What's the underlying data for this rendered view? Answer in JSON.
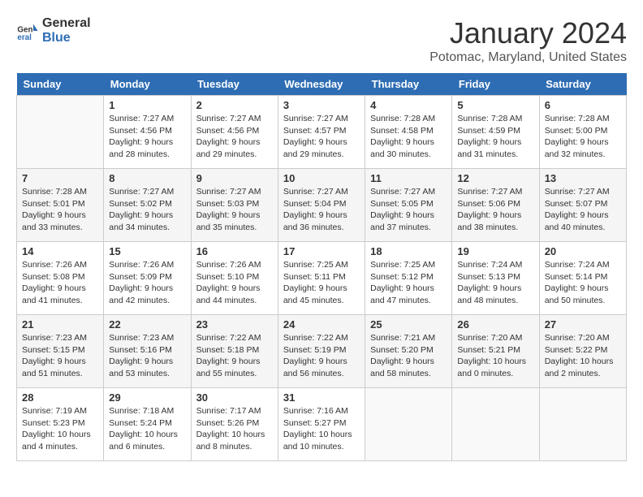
{
  "logo": {
    "line1": "General",
    "line2": "Blue"
  },
  "title": "January 2024",
  "subtitle": "Potomac, Maryland, United States",
  "weekdays": [
    "Sunday",
    "Monday",
    "Tuesday",
    "Wednesday",
    "Thursday",
    "Friday",
    "Saturday"
  ],
  "weeks": [
    [
      {
        "day": "",
        "info": ""
      },
      {
        "day": "1",
        "info": "Sunrise: 7:27 AM\nSunset: 4:56 PM\nDaylight: 9 hours\nand 28 minutes."
      },
      {
        "day": "2",
        "info": "Sunrise: 7:27 AM\nSunset: 4:56 PM\nDaylight: 9 hours\nand 29 minutes."
      },
      {
        "day": "3",
        "info": "Sunrise: 7:27 AM\nSunset: 4:57 PM\nDaylight: 9 hours\nand 29 minutes."
      },
      {
        "day": "4",
        "info": "Sunrise: 7:28 AM\nSunset: 4:58 PM\nDaylight: 9 hours\nand 30 minutes."
      },
      {
        "day": "5",
        "info": "Sunrise: 7:28 AM\nSunset: 4:59 PM\nDaylight: 9 hours\nand 31 minutes."
      },
      {
        "day": "6",
        "info": "Sunrise: 7:28 AM\nSunset: 5:00 PM\nDaylight: 9 hours\nand 32 minutes."
      }
    ],
    [
      {
        "day": "7",
        "info": "Sunrise: 7:28 AM\nSunset: 5:01 PM\nDaylight: 9 hours\nand 33 minutes."
      },
      {
        "day": "8",
        "info": "Sunrise: 7:27 AM\nSunset: 5:02 PM\nDaylight: 9 hours\nand 34 minutes."
      },
      {
        "day": "9",
        "info": "Sunrise: 7:27 AM\nSunset: 5:03 PM\nDaylight: 9 hours\nand 35 minutes."
      },
      {
        "day": "10",
        "info": "Sunrise: 7:27 AM\nSunset: 5:04 PM\nDaylight: 9 hours\nand 36 minutes."
      },
      {
        "day": "11",
        "info": "Sunrise: 7:27 AM\nSunset: 5:05 PM\nDaylight: 9 hours\nand 37 minutes."
      },
      {
        "day": "12",
        "info": "Sunrise: 7:27 AM\nSunset: 5:06 PM\nDaylight: 9 hours\nand 38 minutes."
      },
      {
        "day": "13",
        "info": "Sunrise: 7:27 AM\nSunset: 5:07 PM\nDaylight: 9 hours\nand 40 minutes."
      }
    ],
    [
      {
        "day": "14",
        "info": "Sunrise: 7:26 AM\nSunset: 5:08 PM\nDaylight: 9 hours\nand 41 minutes."
      },
      {
        "day": "15",
        "info": "Sunrise: 7:26 AM\nSunset: 5:09 PM\nDaylight: 9 hours\nand 42 minutes."
      },
      {
        "day": "16",
        "info": "Sunrise: 7:26 AM\nSunset: 5:10 PM\nDaylight: 9 hours\nand 44 minutes."
      },
      {
        "day": "17",
        "info": "Sunrise: 7:25 AM\nSunset: 5:11 PM\nDaylight: 9 hours\nand 45 minutes."
      },
      {
        "day": "18",
        "info": "Sunrise: 7:25 AM\nSunset: 5:12 PM\nDaylight: 9 hours\nand 47 minutes."
      },
      {
        "day": "19",
        "info": "Sunrise: 7:24 AM\nSunset: 5:13 PM\nDaylight: 9 hours\nand 48 minutes."
      },
      {
        "day": "20",
        "info": "Sunrise: 7:24 AM\nSunset: 5:14 PM\nDaylight: 9 hours\nand 50 minutes."
      }
    ],
    [
      {
        "day": "21",
        "info": "Sunrise: 7:23 AM\nSunset: 5:15 PM\nDaylight: 9 hours\nand 51 minutes."
      },
      {
        "day": "22",
        "info": "Sunrise: 7:23 AM\nSunset: 5:16 PM\nDaylight: 9 hours\nand 53 minutes."
      },
      {
        "day": "23",
        "info": "Sunrise: 7:22 AM\nSunset: 5:18 PM\nDaylight: 9 hours\nand 55 minutes."
      },
      {
        "day": "24",
        "info": "Sunrise: 7:22 AM\nSunset: 5:19 PM\nDaylight: 9 hours\nand 56 minutes."
      },
      {
        "day": "25",
        "info": "Sunrise: 7:21 AM\nSunset: 5:20 PM\nDaylight: 9 hours\nand 58 minutes."
      },
      {
        "day": "26",
        "info": "Sunrise: 7:20 AM\nSunset: 5:21 PM\nDaylight: 10 hours\nand 0 minutes."
      },
      {
        "day": "27",
        "info": "Sunrise: 7:20 AM\nSunset: 5:22 PM\nDaylight: 10 hours\nand 2 minutes."
      }
    ],
    [
      {
        "day": "28",
        "info": "Sunrise: 7:19 AM\nSunset: 5:23 PM\nDaylight: 10 hours\nand 4 minutes."
      },
      {
        "day": "29",
        "info": "Sunrise: 7:18 AM\nSunset: 5:24 PM\nDaylight: 10 hours\nand 6 minutes."
      },
      {
        "day": "30",
        "info": "Sunrise: 7:17 AM\nSunset: 5:26 PM\nDaylight: 10 hours\nand 8 minutes."
      },
      {
        "day": "31",
        "info": "Sunrise: 7:16 AM\nSunset: 5:27 PM\nDaylight: 10 hours\nand 10 minutes."
      },
      {
        "day": "",
        "info": ""
      },
      {
        "day": "",
        "info": ""
      },
      {
        "day": "",
        "info": ""
      }
    ]
  ]
}
